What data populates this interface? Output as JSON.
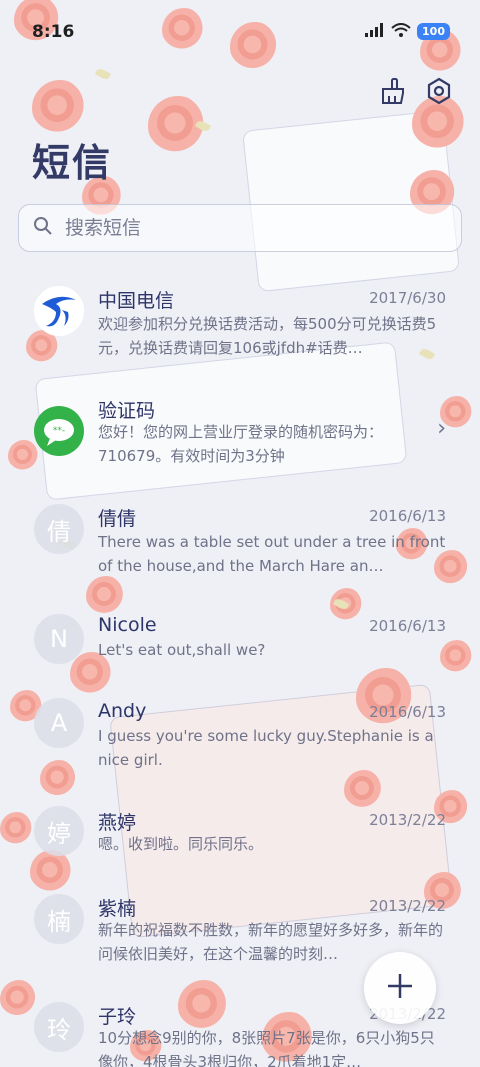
{
  "status_bar": {
    "time": "8:16",
    "battery": "100"
  },
  "title": "短信",
  "search": {
    "placeholder": "搜索短信"
  },
  "messages": [
    {
      "name": "中国电信",
      "date": "2017/6/30",
      "preview": "欢迎参加积分兑换话费活动，每500分可兑换话费5元，兑换话费请回复106或jfdh#话费…",
      "avatar": ""
    },
    {
      "name": "验证码",
      "date": "",
      "preview": "您好！您的网上营业厅登录的随机密码为：710679。有效时间为3分钟",
      "avatar": ""
    },
    {
      "name": "倩倩",
      "date": "2016/6/13",
      "preview": "There was a table set out under a tree in front of the house,and the March Hare an…",
      "avatar": "倩"
    },
    {
      "name": "Nicole",
      "date": "2016/6/13",
      "preview": "Let's eat out,shall we?",
      "avatar": "N"
    },
    {
      "name": "Andy",
      "date": "2016/6/13",
      "preview": "I guess you're some lucky guy.Stephanie is a nice girl.",
      "avatar": "A"
    },
    {
      "name": "燕婷",
      "date": "2013/2/22",
      "preview": "嗯。收到啦。同乐同乐。",
      "avatar": "婷"
    },
    {
      "name": "紫楠",
      "date": "2013/2/22",
      "preview": "新年的祝福数不胜数，新年的愿望好多好多，新年的问候依旧美好，在这个温馨的时刻…",
      "avatar": "楠"
    },
    {
      "name": "子玲",
      "date": "2013/2/22",
      "preview": "10分想念9别的你，8张照片7张是你，6只小狗5只像你，4根骨头3根归你，2爪着地1定…",
      "avatar": "玲"
    }
  ],
  "colors": {
    "accent": "#333a66",
    "telecom_blue": "#1f5bd6",
    "otp_green": "#34b24a"
  }
}
